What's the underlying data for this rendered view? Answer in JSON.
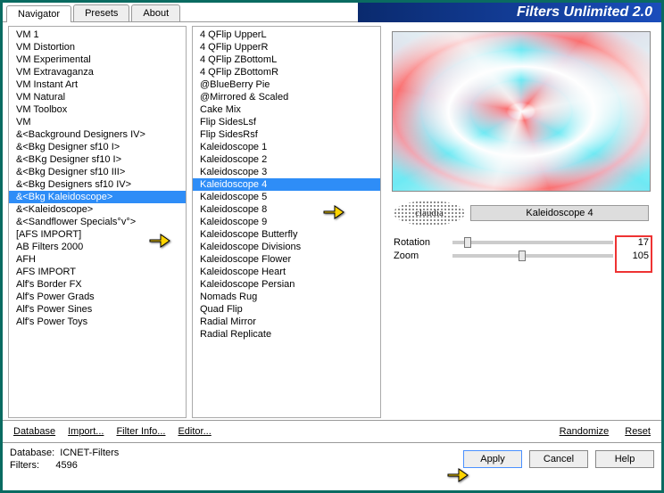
{
  "brand": "Filters Unlimited 2.0",
  "tabs": [
    "Navigator",
    "Presets",
    "About"
  ],
  "activeTab": 0,
  "leftList": {
    "items": [
      "VM 1",
      "VM Distortion",
      "VM Experimental",
      "VM Extravaganza",
      "VM Instant Art",
      "VM Natural",
      "VM Toolbox",
      "VM",
      "&<Background Designers IV>",
      "&<Bkg Designer sf10 I>",
      "&<BKg Designer sf10 I>",
      "&<Bkg Designer sf10 III>",
      "&<Bkg Designers sf10 IV>",
      "&<Bkg Kaleidoscope>",
      "&<Kaleidoscope>",
      "&<Sandflower Specials°v°>",
      "[AFS IMPORT]",
      "AB Filters 2000",
      "AFH",
      "AFS IMPORT",
      "Alf's Border FX",
      "Alf's Power Grads",
      "Alf's Power Sines",
      "Alf's Power Toys"
    ],
    "selectedIndex": 13
  },
  "midList": {
    "items": [
      "4 QFlip UpperL",
      "4 QFlip UpperR",
      "4 QFlip ZBottomL",
      "4 QFlip ZBottomR",
      "@BlueBerry Pie",
      "@Mirrored & Scaled",
      "Cake Mix",
      "Flip SidesLsf",
      "Flip SidesRsf",
      "Kaleidoscope 1",
      "Kaleidoscope 2",
      "Kaleidoscope 3",
      "Kaleidoscope 4",
      "Kaleidoscope 5",
      "Kaleidoscope 8",
      "Kaleidoscope 9",
      "Kaleidoscope Butterfly",
      "Kaleidoscope Divisions",
      "Kaleidoscope Flower",
      "Kaleidoscope Heart",
      "Kaleidoscope Persian",
      "Nomads Rug",
      "Quad Flip",
      "Radial Mirror",
      "Radial Replicate"
    ],
    "selectedIndex": 12
  },
  "stamp": "claudia",
  "selectedFilterName": "Kaleidoscope 4",
  "params": [
    {
      "label": "Rotation",
      "value": 17,
      "pct": 7
    },
    {
      "label": "Zoom",
      "value": 105,
      "pct": 41
    }
  ],
  "linkButtons": {
    "database": "Database",
    "import": "Import...",
    "filterInfo": "Filter Info...",
    "editor": "Editor..."
  },
  "rightButtons": {
    "randomize": "Randomize",
    "reset": "Reset"
  },
  "footer": {
    "dbLabel": "Database:",
    "dbValue": "ICNET-Filters",
    "filtersLabel": "Filters:",
    "filtersValue": "4596"
  },
  "osButtons": {
    "apply": "Apply",
    "cancel": "Cancel",
    "help": "Help"
  }
}
